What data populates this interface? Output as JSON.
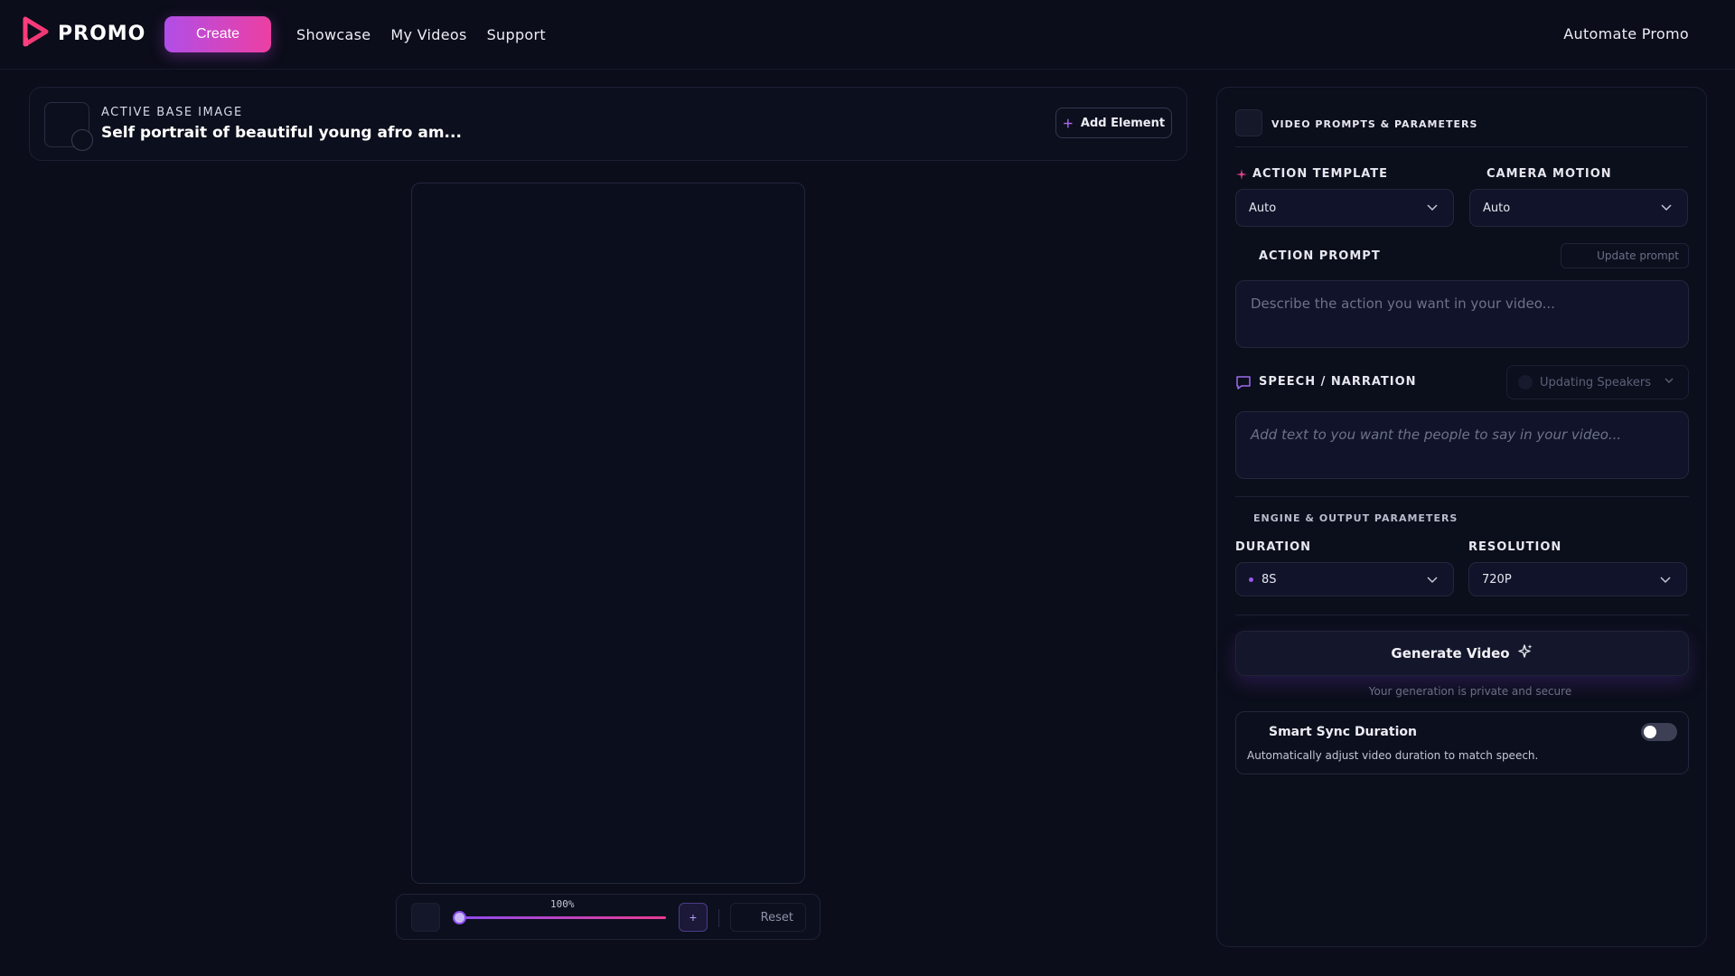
{
  "header": {
    "brand": "PROMO",
    "create_label": "Create",
    "nav": [
      {
        "label": "Showcase"
      },
      {
        "label": "My Videos"
      },
      {
        "label": "Support"
      }
    ],
    "automate_label": "Automate Promo",
    "brand_colors": {
      "logo_start": "#ff3d7f",
      "logo_end": "#b14ee8"
    }
  },
  "base_image": {
    "label": "ACTIVE BASE IMAGE",
    "title": "Self portrait of beautiful young afro am...",
    "add_element_label": "Add Element"
  },
  "zoom": {
    "value_label": "100%",
    "level": 0,
    "plus_label": "+",
    "reset_label": "Reset"
  },
  "panel": {
    "title": "VIDEO PROMPTS & PARAMETERS",
    "action_template": {
      "label": "ACTION TEMPLATE",
      "value": "Auto"
    },
    "camera_motion": {
      "label": "CAMERA MOTION",
      "value": "Auto"
    },
    "action_prompt": {
      "label": "ACTION PROMPT",
      "update_label": "Update prompt",
      "placeholder": "Describe the action you want in your video..."
    },
    "speech": {
      "label": "SPEECH / NARRATION",
      "speakers_label": "Updating Speakers",
      "placeholder": "Add text to you want the people to say in your video..."
    },
    "engine_label": "ENGINE & OUTPUT PARAMETERS",
    "duration": {
      "label": "DURATION",
      "value": "8S"
    },
    "resolution": {
      "label": "RESOLUTION",
      "value": "720P"
    },
    "generate_label": "Generate Video",
    "secure_text": "Your generation is private and secure",
    "smart_sync": {
      "title": "Smart Sync Duration",
      "description": "Automatically adjust video duration to match speech.",
      "enabled": false
    },
    "accent_color": "#9b58f0"
  }
}
